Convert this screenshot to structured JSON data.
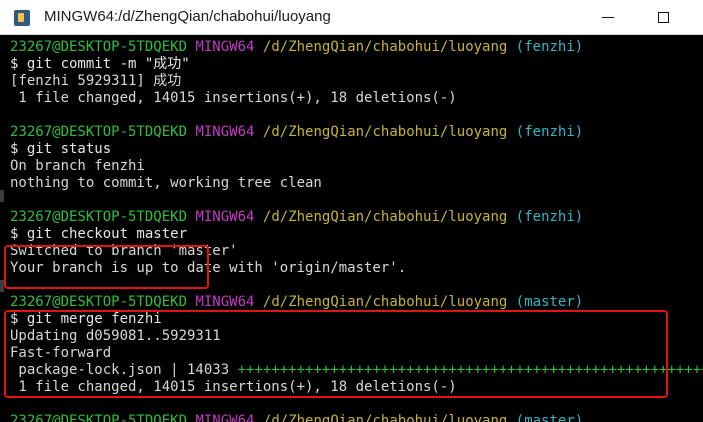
{
  "window": {
    "title": "MINGW64:/d/ZhengQian/chabohui/luoyang",
    "minimize_label": "",
    "maximize_label": ""
  },
  "prompt": {
    "user_host": "23267@DESKTOP-5TDQEKD",
    "shell": "MINGW64",
    "path": "/d/ZhengQian/chabohui/luoyang"
  },
  "lines": [
    {
      "type": "prompt",
      "branch": "(fenzhi)"
    },
    {
      "type": "cmd",
      "text": "$ git commit -m \"成功\""
    },
    {
      "type": "out",
      "text": "[fenzhi 5929311] 成功"
    },
    {
      "type": "out",
      "text": " 1 file changed, 14015 insertions(+), 18 deletions(-)"
    },
    {
      "type": "blank",
      "text": ""
    },
    {
      "type": "prompt",
      "branch": "(fenzhi)"
    },
    {
      "type": "cmd",
      "text": "$ git status"
    },
    {
      "type": "out",
      "text": "On branch fenzhi"
    },
    {
      "type": "out",
      "text": "nothing to commit, working tree clean"
    },
    {
      "type": "blank",
      "text": ""
    },
    {
      "type": "prompt",
      "branch": "(fenzhi)"
    },
    {
      "type": "cmd",
      "text": "$ git checkout master"
    },
    {
      "type": "out",
      "text": "Switched to branch 'master'"
    },
    {
      "type": "out",
      "text": "Your branch is up to date with 'origin/master'."
    },
    {
      "type": "blank",
      "text": ""
    },
    {
      "type": "prompt",
      "branch": "(master)"
    },
    {
      "type": "cmd",
      "text": "$ git merge fenzhi"
    },
    {
      "type": "out",
      "text": "Updating d059081..5929311"
    },
    {
      "type": "out",
      "text": "Fast-forward"
    },
    {
      "type": "diffstat",
      "file": " package-lock.json | 14033 ",
      "plus": "++++++++++++++++++++++++++++++++++++++++++++++++++++++++++",
      "minus": ""
    },
    {
      "type": "out",
      "text": " 1 file changed, 14015 insertions(+), 18 deletions(-)"
    },
    {
      "type": "blank",
      "text": ""
    },
    {
      "type": "prompt",
      "branch": "(master)"
    }
  ]
}
